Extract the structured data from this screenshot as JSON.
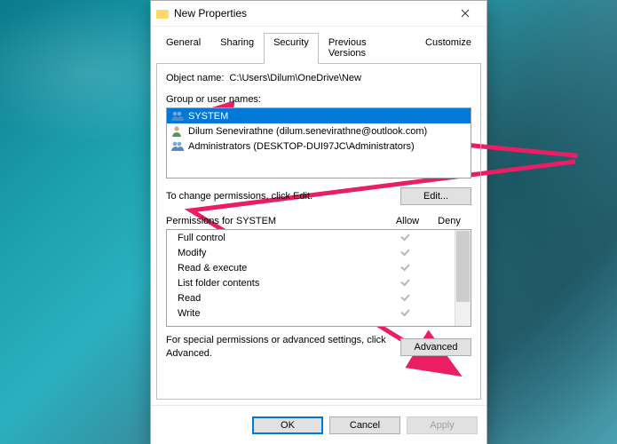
{
  "window": {
    "title": "New Properties"
  },
  "tabs": {
    "items": [
      {
        "label": "General"
      },
      {
        "label": "Sharing"
      },
      {
        "label": "Security"
      },
      {
        "label": "Previous Versions"
      },
      {
        "label": "Customize"
      }
    ],
    "active_index": 2
  },
  "object": {
    "label": "Object name:",
    "path": "C:\\Users\\Dilum\\OneDrive\\New"
  },
  "groups": {
    "label": "Group or user names:",
    "items": [
      {
        "icon": "group",
        "name": "SYSTEM",
        "selected": true
      },
      {
        "icon": "user",
        "name": "Dilum Senevirathne (dilum.senevirathne@outlook.com)",
        "selected": false
      },
      {
        "icon": "group",
        "name": "Administrators (DESKTOP-DUI97JC\\Administrators)",
        "selected": false
      }
    ]
  },
  "edit": {
    "text": "To change permissions, click Edit.",
    "button": "Edit..."
  },
  "permissions": {
    "header_for": "Permissions for SYSTEM",
    "col_allow": "Allow",
    "col_deny": "Deny",
    "rows": [
      {
        "label": "Full control",
        "allow": true,
        "deny": false
      },
      {
        "label": "Modify",
        "allow": true,
        "deny": false
      },
      {
        "label": "Read & execute",
        "allow": true,
        "deny": false
      },
      {
        "label": "List folder contents",
        "allow": true,
        "deny": false
      },
      {
        "label": "Read",
        "allow": true,
        "deny": false
      },
      {
        "label": "Write",
        "allow": true,
        "deny": false
      }
    ]
  },
  "advanced": {
    "text": "For special permissions or advanced settings, click Advanced.",
    "button": "Advanced"
  },
  "buttons": {
    "ok": "OK",
    "cancel": "Cancel",
    "apply": "Apply"
  },
  "annotations": {
    "arrow1_color": "#e91e63",
    "arrow2_color": "#e91e63"
  }
}
